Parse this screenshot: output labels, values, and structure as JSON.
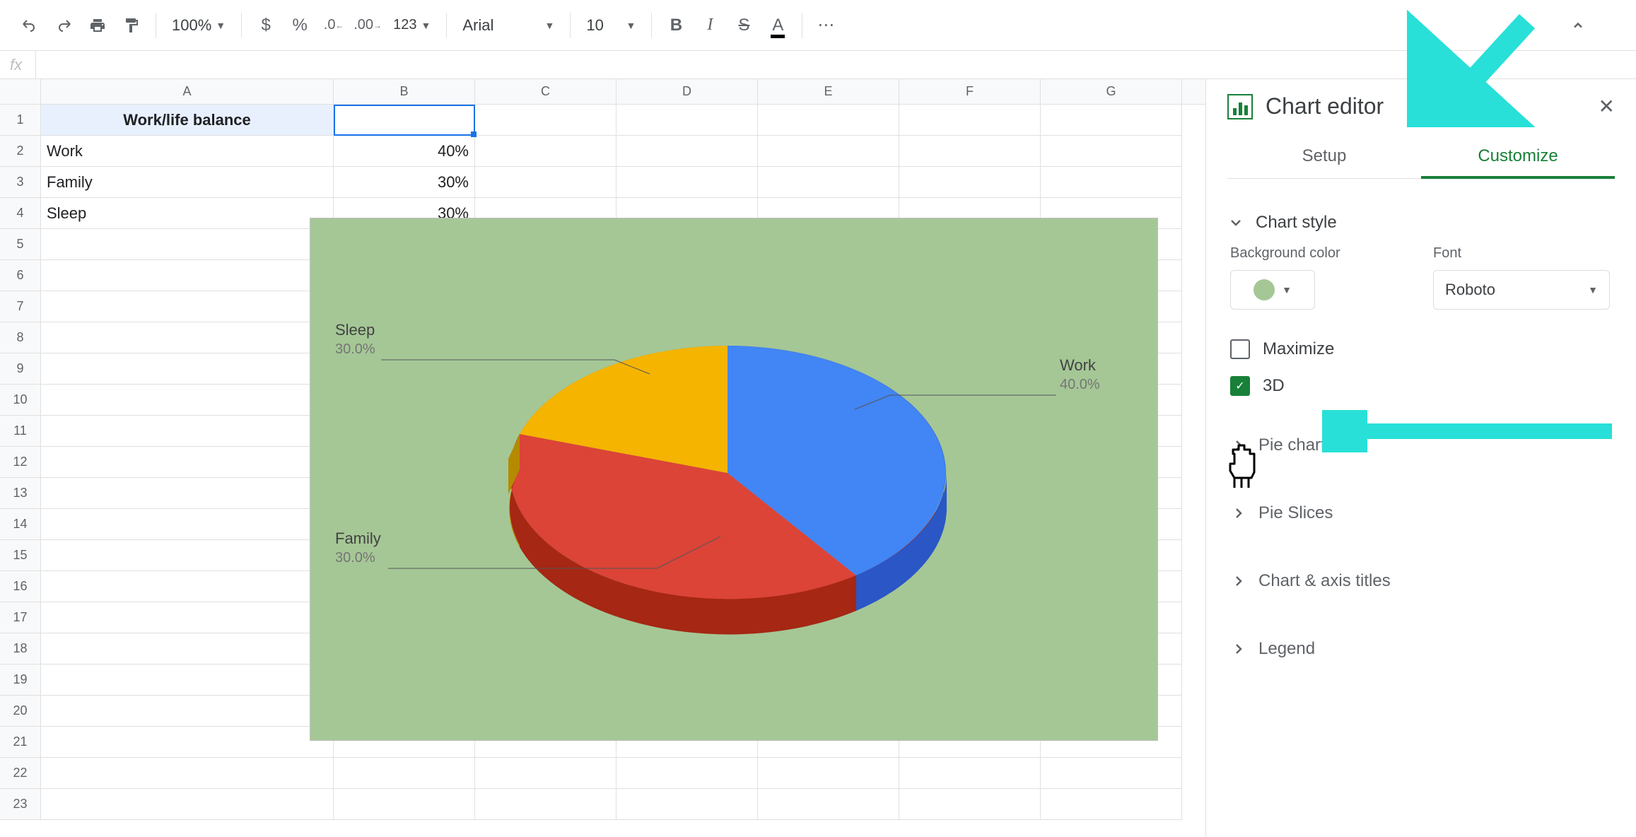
{
  "toolbar": {
    "zoom": "100%",
    "font": "Arial",
    "fontSize": "10"
  },
  "columns": [
    "A",
    "B",
    "C",
    "D",
    "E",
    "F",
    "G"
  ],
  "rows": [
    "1",
    "2",
    "3",
    "4",
    "5",
    "6",
    "7",
    "8",
    "9",
    "10",
    "11",
    "12",
    "13",
    "14",
    "15",
    "16",
    "17",
    "18",
    "19",
    "20",
    "21",
    "22",
    "23"
  ],
  "cells": {
    "A1": "Work/life balance",
    "A2": "Work",
    "B2": "40%",
    "A3": "Family",
    "B3": "30%",
    "A4": "Sleep",
    "B4": "30%"
  },
  "chart_data": {
    "type": "pie",
    "title": "",
    "series": [
      {
        "name": "Work",
        "value": 40,
        "label": "40.0%",
        "color": "#4285f4"
      },
      {
        "name": "Family",
        "value": 30,
        "label": "30.0%",
        "color": "#db4437"
      },
      {
        "name": "Sleep",
        "value": 30,
        "label": "30.0%",
        "color": "#f4b400"
      }
    ],
    "is3D": true,
    "background": "#a5c796"
  },
  "chartLabels": {
    "work": "Work",
    "workPct": "40.0%",
    "family": "Family",
    "familyPct": "30.0%",
    "sleep": "Sleep",
    "sleepPct": "30.0%"
  },
  "panel": {
    "title": "Chart editor",
    "tabs": {
      "setup": "Setup",
      "customize": "Customize"
    },
    "sections": {
      "chartStyle": "Chart style",
      "bgColor": "Background color",
      "font": "Font",
      "fontValue": "Roboto",
      "maximize": "Maximize",
      "threeD": "3D",
      "pieChart": "Pie chart",
      "pieSlices": "Pie Slices",
      "chartAxis": "Chart & axis titles",
      "legend": "Legend"
    }
  }
}
